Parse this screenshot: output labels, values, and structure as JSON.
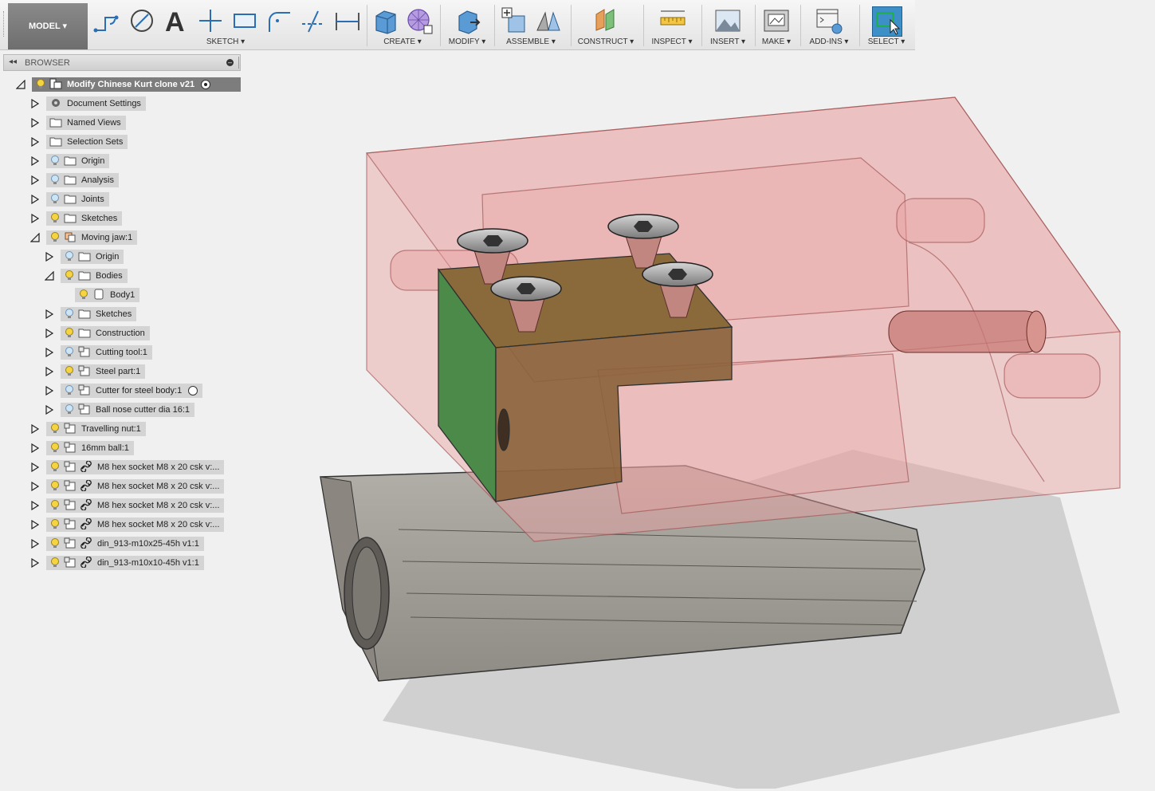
{
  "toolbar": {
    "model_label": "MODEL",
    "groups": [
      {
        "label": "SKETCH ▾"
      },
      {
        "label": "CREATE ▾"
      },
      {
        "label": "MODIFY ▾"
      },
      {
        "label": "ASSEMBLE ▾"
      },
      {
        "label": "CONSTRUCT ▾"
      },
      {
        "label": "INSPECT ▾"
      },
      {
        "label": "INSERT ▾"
      },
      {
        "label": "MAKE ▾"
      },
      {
        "label": "ADD-INS ▾"
      },
      {
        "label": "SELECT ▾"
      }
    ]
  },
  "browser": {
    "title": "BROWSER",
    "root": "Modify Chinese Kurt clone v21",
    "items": [
      {
        "label": "Document Settings"
      },
      {
        "label": "Named Views"
      },
      {
        "label": "Selection Sets"
      },
      {
        "label": "Origin"
      },
      {
        "label": "Analysis"
      },
      {
        "label": "Joints"
      },
      {
        "label": "Sketches"
      },
      {
        "label": "Moving jaw:1"
      },
      {
        "label": "Origin"
      },
      {
        "label": "Bodies"
      },
      {
        "label": "Body1"
      },
      {
        "label": "Sketches"
      },
      {
        "label": "Construction"
      },
      {
        "label": "Cutting tool:1"
      },
      {
        "label": "Steel part:1"
      },
      {
        "label": "Cutter for steel body:1"
      },
      {
        "label": "Ball nose cutter dia 16:1"
      },
      {
        "label": "Travelling nut:1"
      },
      {
        "label": "16mm ball:1"
      },
      {
        "label": "M8 hex socket M8 x 20 csk v:..."
      },
      {
        "label": "M8 hex socket M8 x 20 csk v:..."
      },
      {
        "label": "M8 hex socket M8 x 20 csk v:..."
      },
      {
        "label": "M8 hex socket M8 x 20 csk v:..."
      },
      {
        "label": "din_913-m10x25-45h v1:1"
      },
      {
        "label": "din_913-m10x10-45h v1:1"
      }
    ]
  },
  "colors": {
    "toolbar_bg": "#ebebeb",
    "model_button": "#7a7a7a",
    "tree_item_bg": "#d4d4d4",
    "root_item_bg": "#7d7d7d",
    "body_transparent_red": "#e8a0a0",
    "base_grey": "#9a9690",
    "jaw_green": "#4c8a4a",
    "select_accent": "#3c8fc7"
  }
}
